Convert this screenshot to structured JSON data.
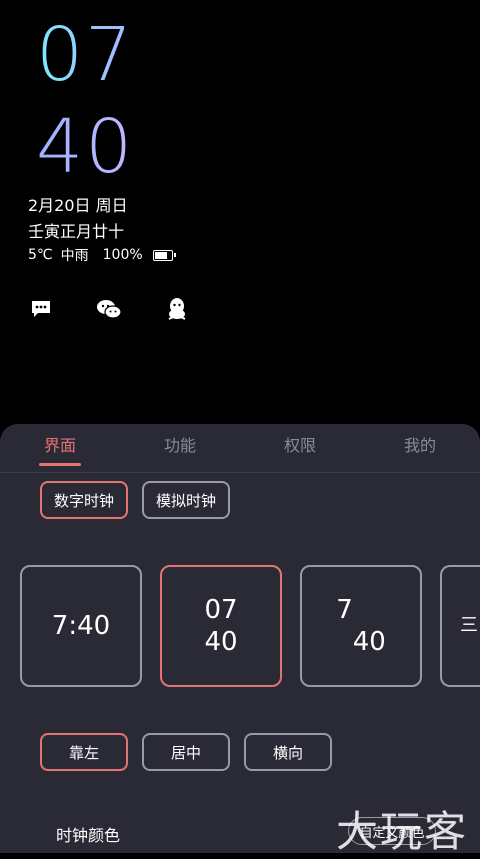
{
  "lockscreen": {
    "hour": "07",
    "minute": "40",
    "date": "2月20日 周日",
    "lunar": "壬寅正月廿十",
    "temperature": "5℃",
    "weather": "中雨",
    "battery_percent": "100%",
    "battery_level": 1.0,
    "notifications": [
      "message-icon",
      "wechat-icon",
      "qq-icon"
    ]
  },
  "tabs": [
    "界面",
    "功能",
    "权限",
    "我的"
  ],
  "clock_type": {
    "options": [
      "数字时钟",
      "模拟时钟"
    ],
    "selected": "数字时钟"
  },
  "styles": {
    "cards": [
      "7:40",
      "07\n40",
      "7\n  40",
      "三"
    ],
    "selected_index": 1
  },
  "alignment": {
    "options": [
      "靠左",
      "居中",
      "横向"
    ],
    "selected": "靠左"
  },
  "clock_color": {
    "label": "时钟颜色",
    "button": "自定义颜色"
  },
  "watermark": "大玩客",
  "colors": {
    "accent": "#e57373",
    "sheet_bg": "#2a2a36",
    "clock_gradient_start": "#7ee8ff",
    "clock_gradient_end": "#c0b6ff"
  }
}
